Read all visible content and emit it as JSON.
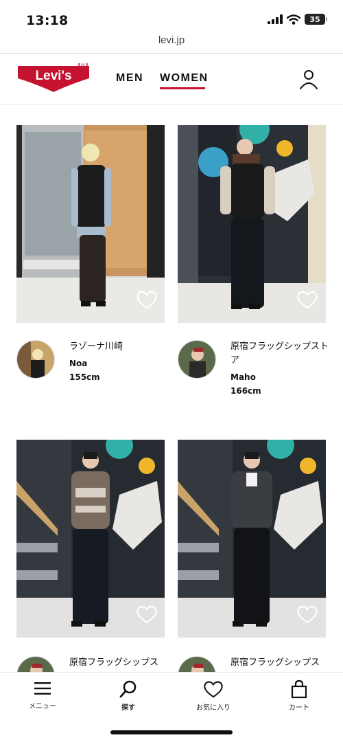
{
  "status": {
    "time": "13:18",
    "battery": "35"
  },
  "url": "levi.jp",
  "header": {
    "logo_text": "Levi's",
    "nav": [
      {
        "label": "MEN"
      },
      {
        "label": "WOMEN",
        "active": true
      }
    ]
  },
  "products": [
    {
      "store": "ラゾーナ川崎",
      "staff": "Noa",
      "height": "155cm"
    },
    {
      "store": "原宿フラッグシップストア",
      "staff": "Maho",
      "height": "166cm"
    },
    {
      "store": "原宿フラッグシップス",
      "staff": "",
      "height": ""
    },
    {
      "store": "原宿フラッグシップス",
      "staff": "",
      "height": ""
    }
  ],
  "tab_bar": {
    "items": [
      {
        "label": "メニュー",
        "icon": "menu-icon"
      },
      {
        "label": "探す",
        "icon": "search-icon"
      },
      {
        "label": "お気に入り",
        "icon": "heart-icon"
      },
      {
        "label": "カート",
        "icon": "bag-icon"
      }
    ]
  },
  "colors": {
    "brand_red": "#c41230",
    "text": "#111111"
  }
}
